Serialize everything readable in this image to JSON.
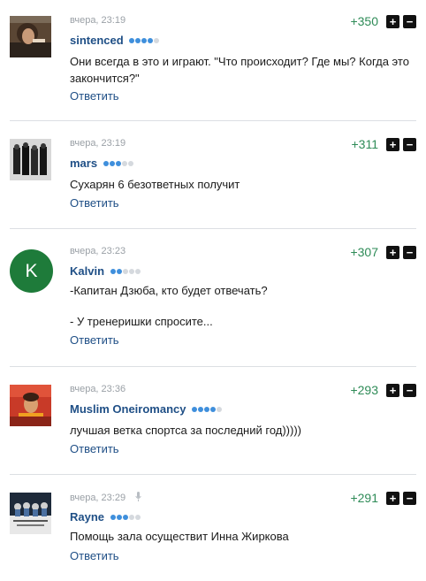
{
  "comments": [
    {
      "time": "вчера, 23:19",
      "user": "sintenced",
      "score": "+350",
      "lines": [
        "Они всегда в это и играют. \"Что происходит? Где мы? Когда это",
        "закончится?\""
      ],
      "reply": "Ответить",
      "avatar_icon": "user-photo-icon"
    },
    {
      "time": "вчера, 23:19",
      "user": "mars",
      "score": "+311",
      "lines": [
        "Сухарян 6 безответных получит"
      ],
      "reply": "Ответить",
      "avatar_icon": "user-photo-icon"
    },
    {
      "time": "вчера, 23:23",
      "user": "Kalvin",
      "score": "+307",
      "avatar_letter": "K",
      "lines": [
        "-Капитан Дзюба, кто будет отвечать?",
        "- У тренеришки спросите..."
      ],
      "reply": "Ответить"
    },
    {
      "time": "вчера, 23:36",
      "user": "Muslim Oneiromancy",
      "score": "+293",
      "lines": [
        "лучшая ветка спортса за последний год)))))"
      ],
      "reply": "Ответить",
      "avatar_icon": "user-photo-icon"
    },
    {
      "time": "вчера, 23:29",
      "user": "Rayne",
      "score": "+291",
      "lines": [
        "Помощь зала осуществит Инна Жиркова"
      ],
      "reply": "Ответить",
      "avatar_icon": "user-photo-icon"
    }
  ],
  "vote": {
    "plus": "+",
    "minus": "−"
  },
  "colors": {
    "username": "#1f4f86",
    "score": "#2e8b57",
    "rating_on": "#3f8fdc",
    "rating_off": "#d5d9de"
  }
}
